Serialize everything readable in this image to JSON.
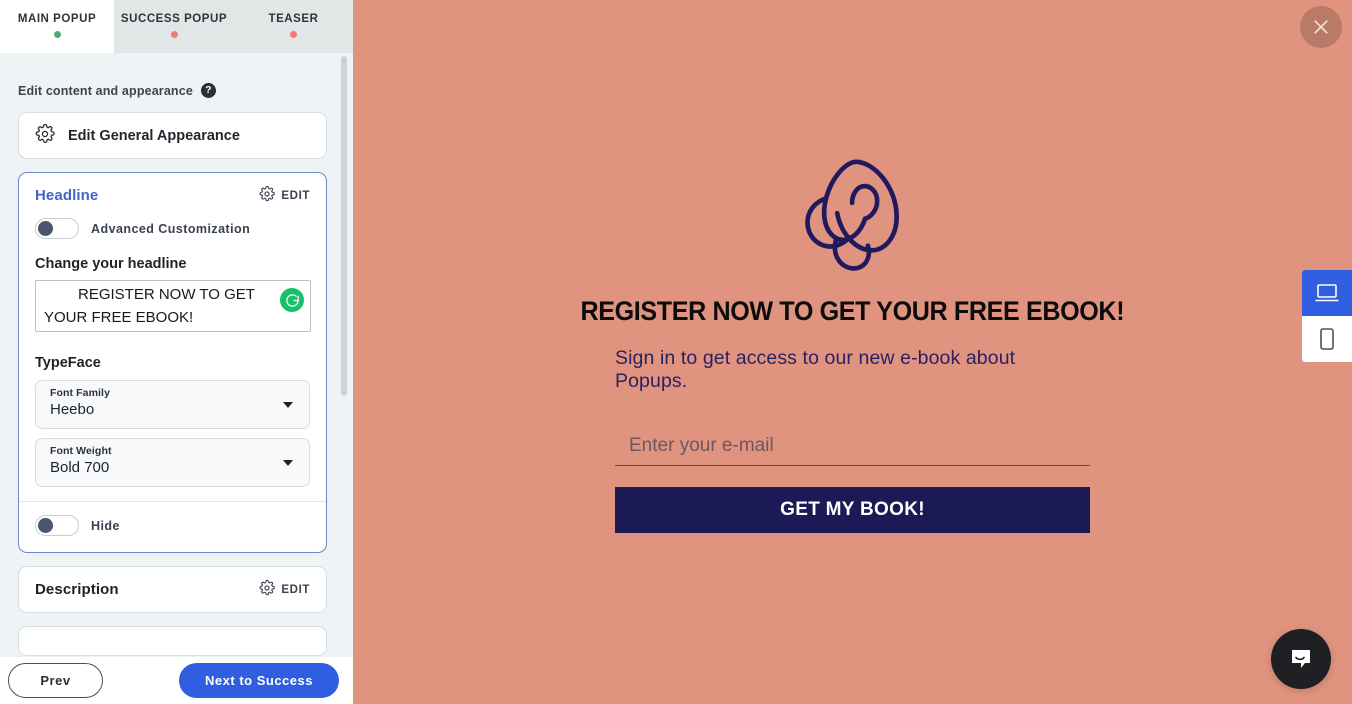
{
  "sidebar": {
    "tabs": [
      {
        "label": "MAIN POPUP",
        "status": "green",
        "active": true
      },
      {
        "label": "SUCCESS POPUP",
        "status": "red",
        "active": false
      },
      {
        "label": "TEASER",
        "status": "red",
        "active": false
      }
    ],
    "subtitle": "Edit content and appearance",
    "help_icon": "question-mark-icon",
    "general_appearance": {
      "label": "Edit General Appearance",
      "icon": "gear-icon"
    },
    "headline_section": {
      "title": "Headline",
      "edit_label": "EDIT",
      "edit_icon": "gear-icon",
      "advanced_toggle_label": "Advanced Customization",
      "advanced_toggle_state": "off",
      "change_label": "Change your headline",
      "headline_value": "REGISTER NOW TO GET YOUR FREE EBOOK!",
      "grammarly_icon": "grammarly-icon",
      "typeface_label": "TypeFace",
      "font_family_caption": "Font Family",
      "font_family_value": "Heebo",
      "font_weight_caption": "Font Weight",
      "font_weight_value": "Bold 700",
      "hide_toggle_label": "Hide",
      "hide_toggle_state": "off"
    },
    "description_section": {
      "title": "Description",
      "edit_label": "EDIT",
      "edit_icon": "gear-icon"
    },
    "actions": {
      "prev_label": "Prev",
      "next_label": "Next to Success"
    }
  },
  "preview": {
    "close_icon": "close-icon",
    "megaphone_icon": "megaphone-icon",
    "headline": "REGISTER NOW TO GET YOUR FREE EBOOK!",
    "subheadline": "Sign in to get access to our new e-book about Popups.",
    "email_placeholder": "Enter your e-mail",
    "email_value": "",
    "cta_label": "GET MY BOOK!",
    "chat_icon": "chat-bubble-icon",
    "devices": [
      {
        "name": "desktop",
        "icon": "laptop-icon",
        "active": true,
        "status": "green"
      },
      {
        "name": "mobile",
        "icon": "phone-icon",
        "active": false,
        "status": "red"
      }
    ]
  },
  "colors": {
    "popup_background": "#e0947f",
    "accent_blue": "#2f5fe0",
    "section_title_blue": "#4067c8",
    "cta_navy": "#1b1a56",
    "status_green": "#4caf72",
    "status_red": "#ef7b7b",
    "grammarly_green": "#15c26b"
  }
}
